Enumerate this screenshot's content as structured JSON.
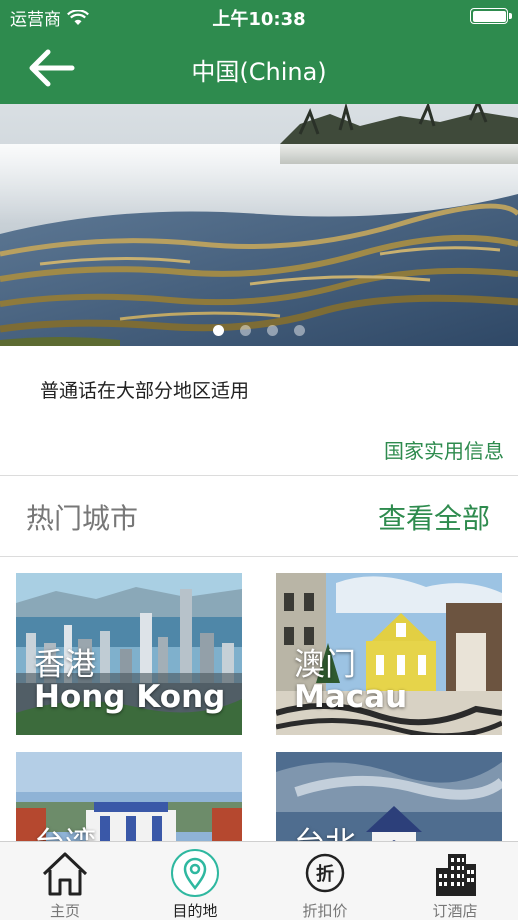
{
  "status_bar": {
    "carrier": "运营商",
    "time": "上午10:38"
  },
  "nav": {
    "title": "中国(China)"
  },
  "banner": {
    "page_count": 4,
    "active_page": 1
  },
  "info": {
    "language_note": "普通话在大部分地区适用",
    "practical_info_link": "国家实用信息"
  },
  "hot_cities": {
    "heading": "热门城市",
    "view_all": "查看全部",
    "cities": [
      {
        "zh": "香港",
        "en": "Hong Kong"
      },
      {
        "zh": "澳门",
        "en": "Macau"
      },
      {
        "zh": "台湾",
        "en": ""
      },
      {
        "zh": "台北",
        "en": ""
      }
    ]
  },
  "tabbar": {
    "tabs": [
      {
        "label": "主页",
        "icon": "home-icon"
      },
      {
        "label": "目的地",
        "icon": "location-pin-icon"
      },
      {
        "label": "折扣价",
        "icon": "discount-icon"
      },
      {
        "label": "订酒店",
        "icon": "hotel-building-icon"
      }
    ],
    "active_index": 1
  },
  "colors": {
    "brand_green": "#2e8b4e",
    "text_gray": "#777777"
  }
}
